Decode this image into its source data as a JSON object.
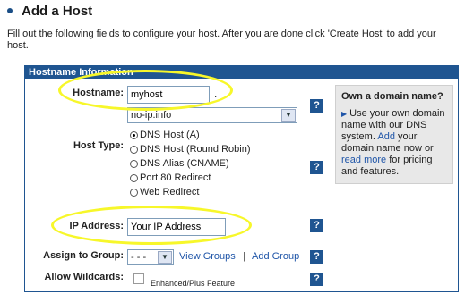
{
  "page": {
    "title": "Add a Host",
    "intro": "Fill out the following fields to configure your host. After you are done click 'Create Host' to add your host."
  },
  "panel": {
    "header": "Hostname Information"
  },
  "hostname": {
    "label": "Hostname:",
    "value": "myhost",
    "dot": ".",
    "domain": "no-ip.info"
  },
  "host_type": {
    "label": "Host Type:",
    "options": [
      "DNS Host (A)",
      "DNS Host (Round Robin)",
      "DNS Alias (CNAME)",
      "Port 80 Redirect",
      "Web Redirect"
    ],
    "selected": "DNS Host (A)"
  },
  "ip_address": {
    "label": "IP Address:",
    "value": "Your IP Address"
  },
  "assign_group": {
    "label": "Assign to Group:",
    "value": "- - -",
    "view_groups": "View Groups",
    "separator": "|",
    "add_group": "Add Group"
  },
  "wildcards": {
    "label": "Allow Wildcards:",
    "note": "Enhanced/Plus Feature",
    "checked": false
  },
  "help_icon": "?",
  "sidebox": {
    "title": "Own a domain name?",
    "line1": "Use your own domain name with our DNS system.",
    "add_link": "Add",
    "line2": "your domain name now or",
    "read_more": "read more",
    "line3": "for pricing and features."
  },
  "colors": {
    "brand": "#1f5591",
    "highlight": "#f7f72a",
    "link": "#1f55a8"
  }
}
